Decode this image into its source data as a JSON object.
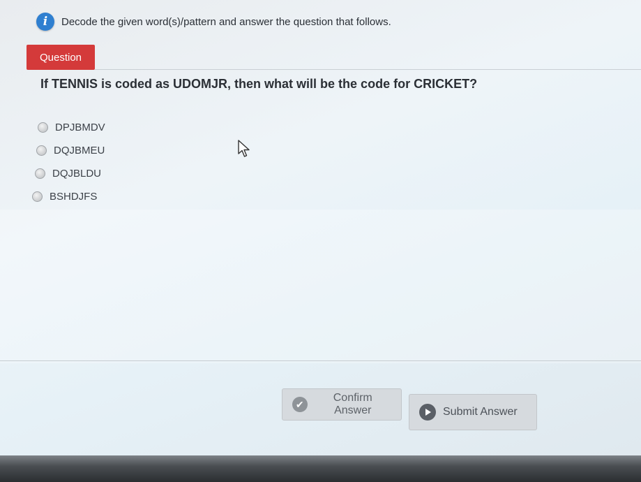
{
  "instruction": {
    "icon": "info-icon",
    "text": "Decode the given word(s)/pattern and answer the question that follows."
  },
  "question_tab": {
    "label": "Question"
  },
  "question": {
    "text": "If TENNIS is coded as UDOMJR, then what will be the code for CRICKET?"
  },
  "options": [
    {
      "label": "DPJBMDV"
    },
    {
      "label": "DQJBMEU"
    },
    {
      "label": "DQJBLDU"
    },
    {
      "label": "BSHDJFS"
    }
  ],
  "buttons": {
    "confirm": {
      "label": "Confirm Answer",
      "icon": "check-icon"
    },
    "submit": {
      "label": "Submit Answer",
      "icon": "play-icon"
    }
  },
  "colors": {
    "question_tab_bg": "#d43a3a",
    "info_icon": "#2f7fd0"
  }
}
